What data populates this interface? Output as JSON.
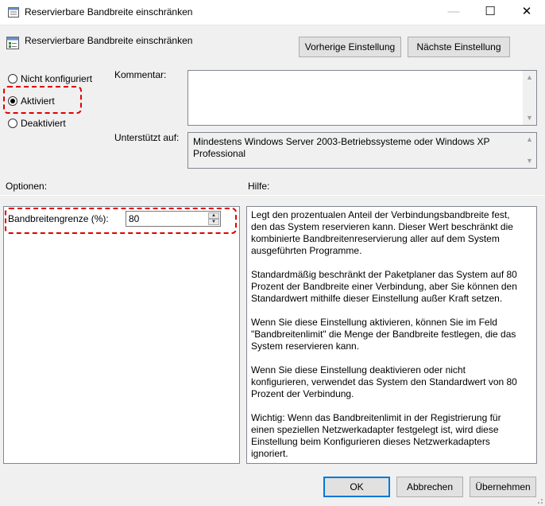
{
  "window": {
    "title": "Reservierbare Bandbreite einschränken",
    "minimize": "—",
    "maximize": "☐",
    "close": "✕"
  },
  "header": {
    "title": "Reservierbare Bandbreite einschränken",
    "prev_label": "Vorherige Einstellung",
    "next_label": "Nächste Einstellung"
  },
  "state": {
    "options": [
      "Nicht konfiguriert",
      "Aktiviert",
      "Deaktiviert"
    ],
    "selected": "Aktiviert"
  },
  "comment": {
    "label": "Kommentar:",
    "value": ""
  },
  "supported": {
    "label": "Unterstützt auf:",
    "value": "Mindestens Windows Server 2003-Betriebssysteme oder Windows XP Professional"
  },
  "options_section": {
    "label": "Optionen:",
    "bandwidth_label": "Bandbreitengrenze (%):",
    "bandwidth_value": "80"
  },
  "help": {
    "label": "Hilfe:",
    "paragraphs": [
      "Legt den prozentualen Anteil der Verbindungsbandbreite fest, den das System reservieren kann. Dieser Wert beschränkt die kombinierte Bandbreitenreservierung aller auf dem System ausgeführten Programme.",
      "Standardmäßig beschränkt der Paketplaner das System auf 80 Prozent der Bandbreite einer Verbindung, aber Sie können den Standardwert mithilfe dieser Einstellung außer Kraft setzen.",
      "Wenn Sie diese Einstellung aktivieren, können Sie im Feld \"Bandbreitenlimit\" die Menge der Bandbreite festlegen, die das System reservieren kann.",
      "Wenn Sie diese Einstellung deaktivieren oder nicht konfigurieren, verwendet das System den Standardwert von 80 Prozent der Verbindung.",
      "Wichtig: Wenn das Bandbreitenlimit in der Registrierung für einen speziellen Netzwerkadapter festgelegt ist, wird diese Einstellung beim Konfigurieren dieses Netzwerkadapters ignoriert."
    ]
  },
  "footer": {
    "ok": "OK",
    "cancel": "Abbrechen",
    "apply": "Übernehmen"
  },
  "colors": {
    "highlight": "#e00000",
    "accent": "#0078d7"
  }
}
